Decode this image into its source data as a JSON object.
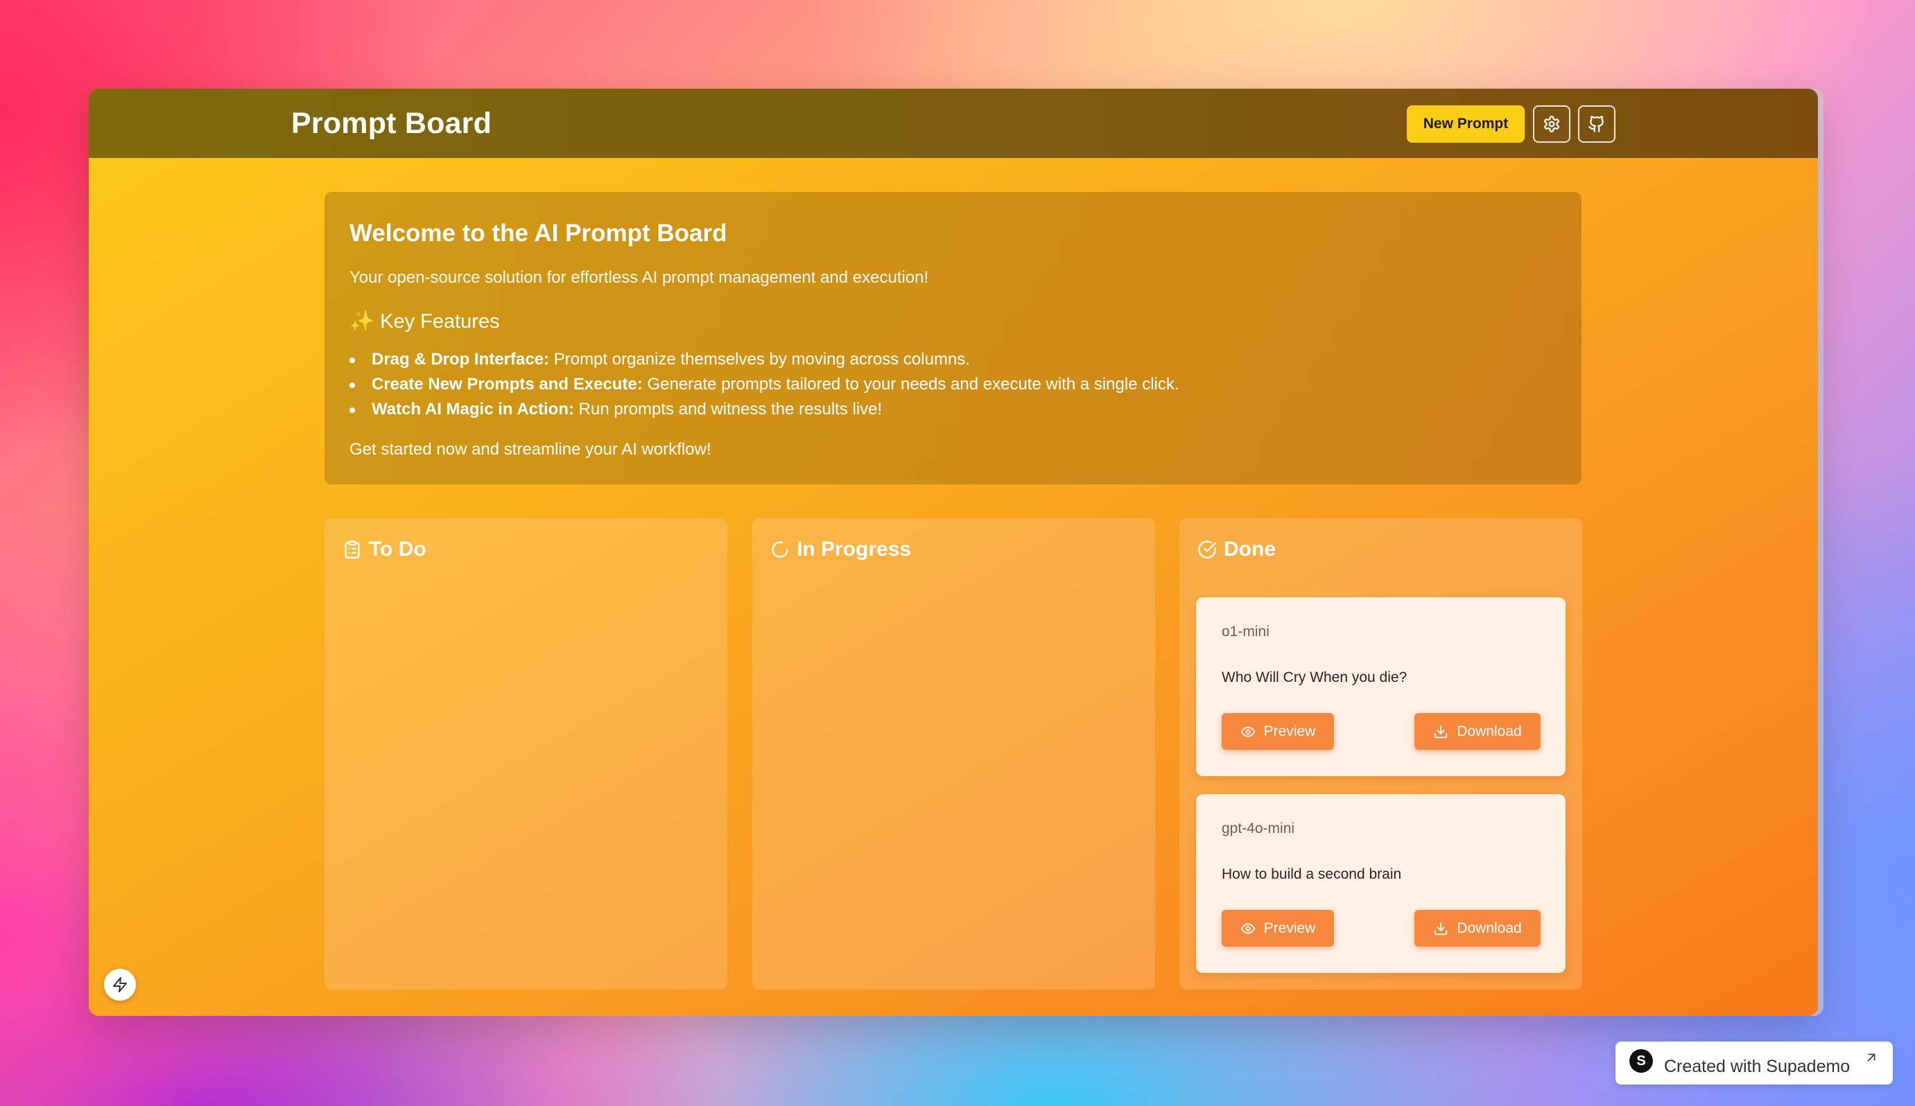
{
  "header": {
    "title": "Prompt Board",
    "new_prompt_label": "New Prompt",
    "settings_icon": "gear-icon",
    "github_icon": "github-icon"
  },
  "welcome": {
    "title": "Welcome to the AI Prompt Board",
    "tagline": "Your open-source solution for effortless AI prompt management and execution!",
    "features_heading_emoji": "✨",
    "features_heading": "Key Features",
    "features": [
      {
        "bold": "Drag & Drop Interface:",
        "text": " Prompt organize themselves by moving across columns."
      },
      {
        "bold": "Create New Prompts and Execute:",
        "text": " Generate prompts tailored to your needs and execute with a single click."
      },
      {
        "bold": "Watch AI Magic in Action:",
        "text": " Run prompts and witness the results live!"
      }
    ],
    "cta": "Get started now and streamline your AI workflow!"
  },
  "columns": {
    "todo": {
      "label": "To Do",
      "icon": "clipboard-icon"
    },
    "in_progress": {
      "label": "In Progress",
      "icon": "loader-icon"
    },
    "done": {
      "label": "Done",
      "icon": "check-circle-icon"
    }
  },
  "done_cards": [
    {
      "model": "o1-mini",
      "title": "Who Will Cry When you die?",
      "preview_label": "Preview",
      "download_label": "Download"
    },
    {
      "model": "gpt-4o-mini",
      "title": "How to build a second brain",
      "preview_label": "Preview",
      "download_label": "Download"
    }
  ],
  "badge": {
    "logo_letter": "S",
    "text": "Created with Supademo"
  },
  "colors": {
    "header_bg": "#7d5e10",
    "new_prompt_bg": "#fccd17",
    "action_button_bg": "#f5883d",
    "card_bg": "#fff0e6"
  }
}
